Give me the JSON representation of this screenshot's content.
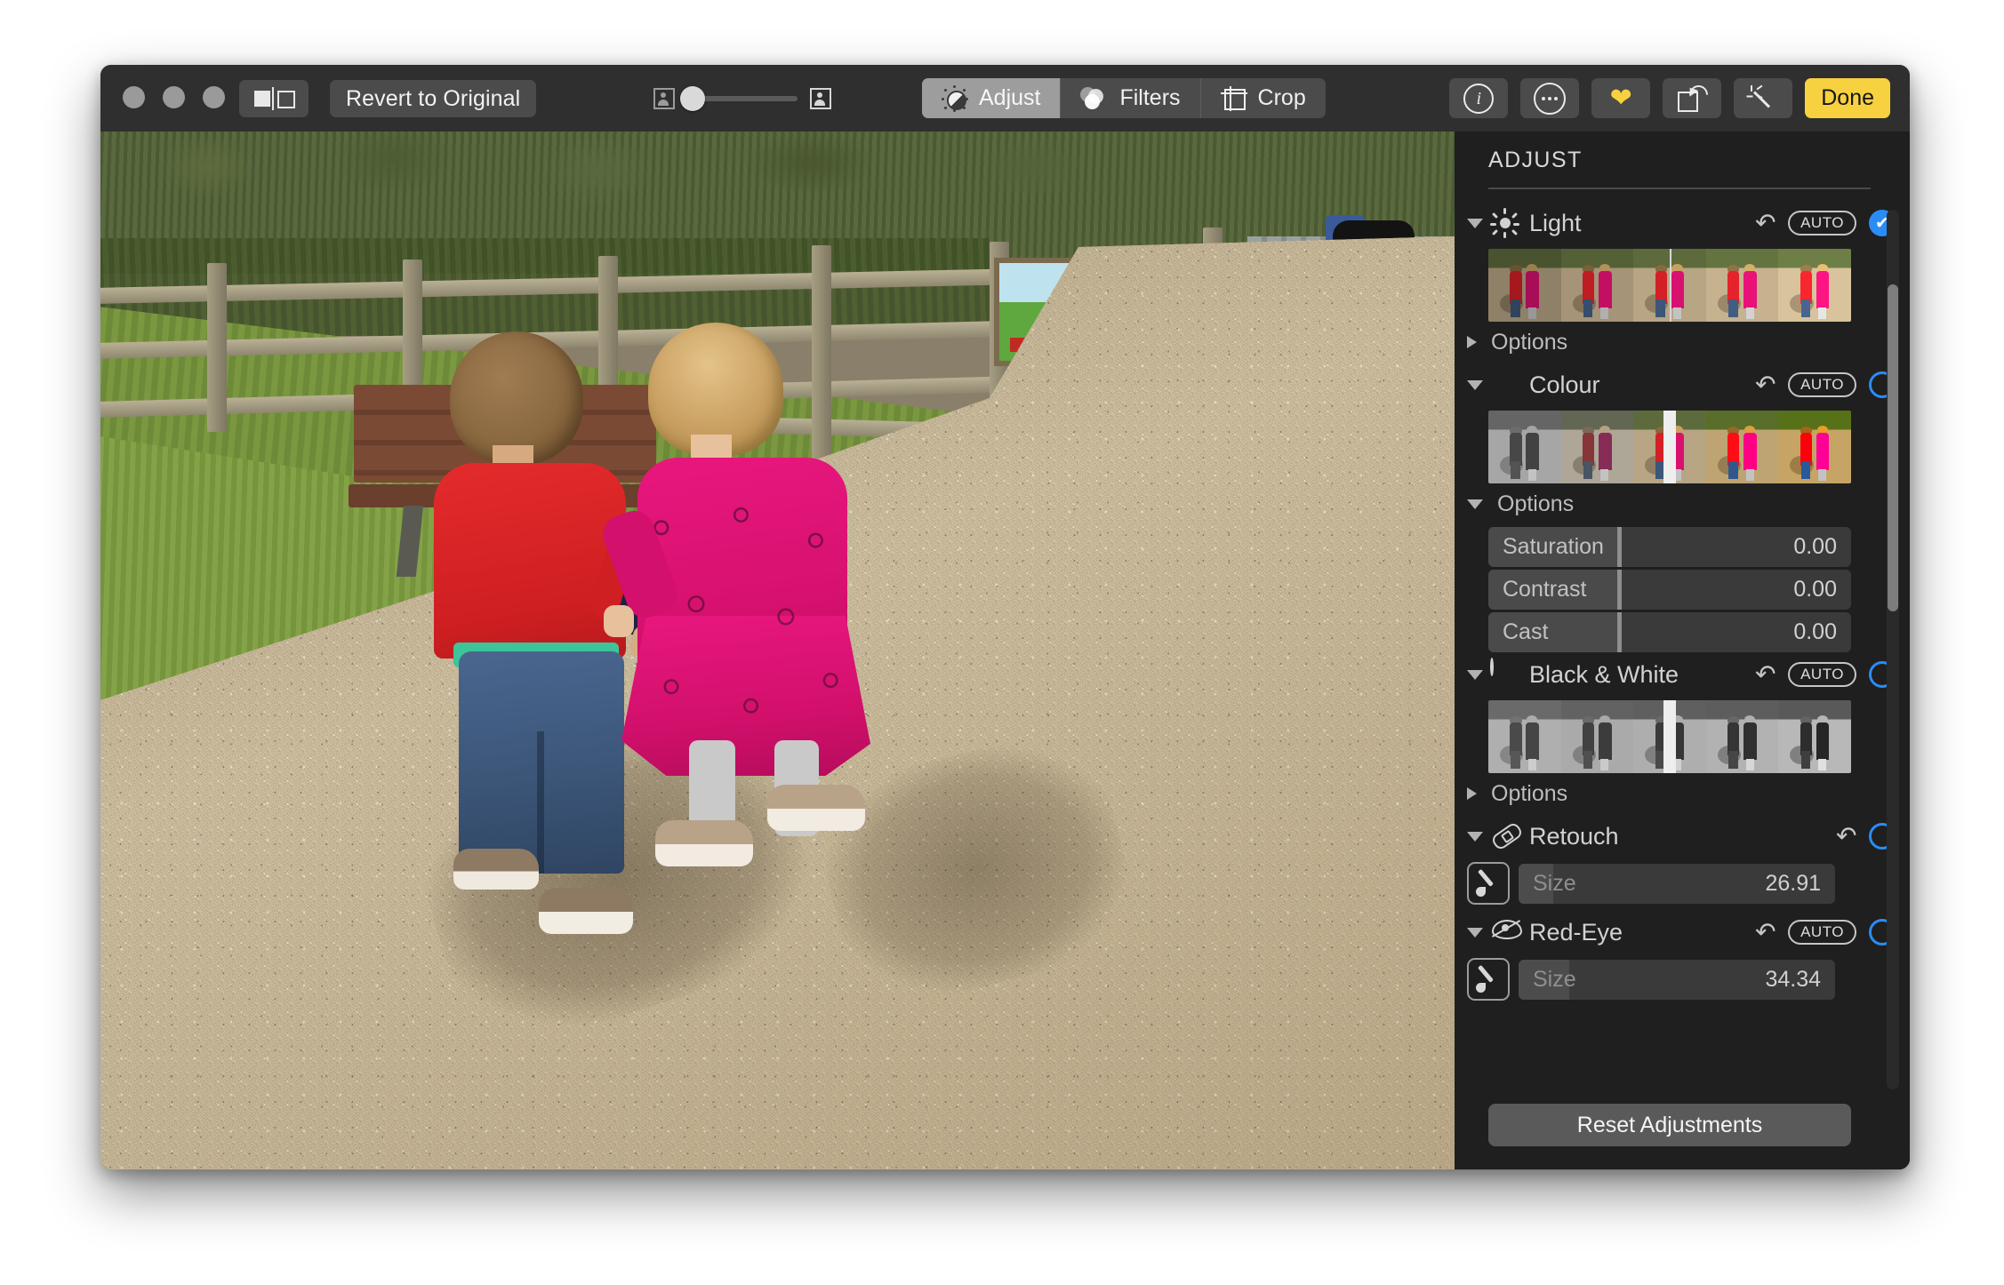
{
  "window": {
    "traffic_lights": [
      "close",
      "minimize",
      "zoom"
    ]
  },
  "toolbar": {
    "split_view_icon": "split-view-icon",
    "revert_label": "Revert to Original",
    "compare_slider": {
      "left_icon": "photo-original-icon",
      "right_icon": "photo-edited-icon",
      "value_percent": 8
    },
    "tabs": [
      {
        "label": "Adjust",
        "icon": "adjust-dial-icon",
        "active": true
      },
      {
        "label": "Filters",
        "icon": "filters-circles-icon",
        "active": false
      },
      {
        "label": "Crop",
        "icon": "crop-frame-icon",
        "active": false
      }
    ],
    "right_buttons": [
      {
        "name": "info-button",
        "icon": "info-icon",
        "label": ""
      },
      {
        "name": "more-button",
        "icon": "ellipsis-icon",
        "label": ""
      },
      {
        "name": "favorite-button",
        "icon": "heart-icon",
        "label": ""
      },
      {
        "name": "rotate-button",
        "icon": "rotate-icon",
        "label": ""
      },
      {
        "name": "enhance-button",
        "icon": "magic-wand-icon",
        "label": ""
      }
    ],
    "done_label": "Done"
  },
  "sidebar": {
    "title": "ADJUST",
    "reset_label": "Reset Adjustments",
    "sections": [
      {
        "id": "light",
        "label": "Light",
        "icon": "sun-icon",
        "expanded": true,
        "has_revert": true,
        "auto_label": "AUTO",
        "toggle_state": "on",
        "options_label": "Options",
        "options_expanded": false,
        "strip_marker_percent": 50
      },
      {
        "id": "colour",
        "label": "Colour",
        "icon": "color-wheel-icon",
        "expanded": true,
        "has_revert": true,
        "auto_label": "AUTO",
        "toggle_state": "off",
        "options_label": "Options",
        "options_expanded": true,
        "strip_marker_percent": 50,
        "sliders": [
          {
            "label": "Saturation",
            "value": "0.00",
            "fill_percent": 36
          },
          {
            "label": "Contrast",
            "value": "0.00",
            "fill_percent": 36
          },
          {
            "label": "Cast",
            "value": "0.00",
            "fill_percent": 36
          }
        ]
      },
      {
        "id": "black-and-white",
        "label": "Black & White",
        "icon": "contrast-circle-icon",
        "expanded": true,
        "has_revert": true,
        "auto_label": "AUTO",
        "toggle_state": "off",
        "options_label": "Options",
        "options_expanded": false,
        "strip_marker_percent": 50
      },
      {
        "id": "retouch",
        "label": "Retouch",
        "icon": "bandage-icon",
        "expanded": true,
        "has_revert": true,
        "auto_label": null,
        "toggle_state": "off",
        "brush": {
          "label": "Size",
          "value": "26.91",
          "fill_percent": 11,
          "icon": "brush-icon"
        }
      },
      {
        "id": "red-eye",
        "label": "Red-Eye",
        "icon": "eye-slash-icon",
        "expanded": true,
        "has_revert": true,
        "auto_label": "AUTO",
        "toggle_state": "off",
        "brush": {
          "label": "Size",
          "value": "34.34",
          "fill_percent": 16,
          "icon": "brush-icon"
        }
      }
    ],
    "scrollbar": {
      "thumb_top_percent": 8,
      "thumb_height_percent": 37
    }
  },
  "photo": {
    "description": "Two toddlers seen from behind walking hand-in-hand on gravel at a farm park; boy in red long-sleeve shirt and jeans, girl in pink bunny-print dress and grey leggings"
  },
  "colors": {
    "accent_blue": "#2b8cf5",
    "done_yellow": "#f7d140",
    "toolbar_bg": "#2f2f2f",
    "sidebar_bg": "#1f1f1f",
    "button_bg": "#4b4b4b",
    "heart_yellow": "#f7d140"
  }
}
